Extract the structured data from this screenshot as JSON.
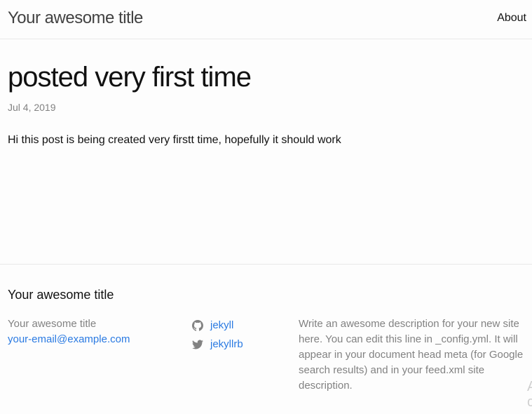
{
  "header": {
    "site_title": "Your awesome title",
    "nav": [
      {
        "label": "About"
      }
    ]
  },
  "post": {
    "title": "posted very first time",
    "date": "Jul 4, 2019",
    "content": "Hi this post is being created very firstt time, hopefully it should work"
  },
  "footer": {
    "heading": "Your awesome title",
    "contact": {
      "name": "Your awesome title",
      "email": "your-email@example.com"
    },
    "social": [
      {
        "icon": "github-icon",
        "label": "jekyll"
      },
      {
        "icon": "twitter-icon",
        "label": "jekyllrb"
      }
    ],
    "description": "Write an awesome description for your new site here. You can edit this line in _config.yml. It will appear in your document head meta (for Google search results) and in your feed.xml site description."
  },
  "colors": {
    "link": "#2a7ae2",
    "muted": "#828282",
    "border": "#e8e8e8",
    "background": "#fdfdfd"
  }
}
